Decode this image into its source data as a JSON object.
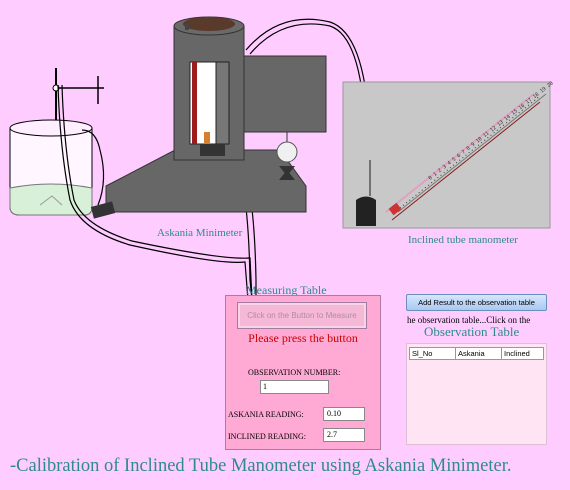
{
  "apparatus": {
    "askania_label": "Askania Minimeter",
    "inclined_label": "Inclined tube manometer"
  },
  "measuring": {
    "title": "Measuring Table",
    "measure_button": "Click on the Button to Measure",
    "prompt": "Please press the button",
    "observation_number_label": "OBSERVATION NUMBER:",
    "observation_number": "1",
    "askania_reading_label": "ASKANIA READING:",
    "askania_reading": "0.10",
    "inclined_reading_label": "INCLINED READING:",
    "inclined_reading": "2.7"
  },
  "observation": {
    "add_button": "Add Result to the observation table",
    "hint": "he observation table...Click on the",
    "title": "Observation Table",
    "columns": [
      "Sl_No",
      "Askania",
      "Inclined"
    ]
  },
  "footer": "-Calibration of Inclined Tube Manometer using Askania Minimeter.",
  "colors": {
    "background": "#ffccff",
    "accent_teal": "#2e8b8b",
    "prompt_red": "#cc0000",
    "machine_gray": "#666666"
  }
}
